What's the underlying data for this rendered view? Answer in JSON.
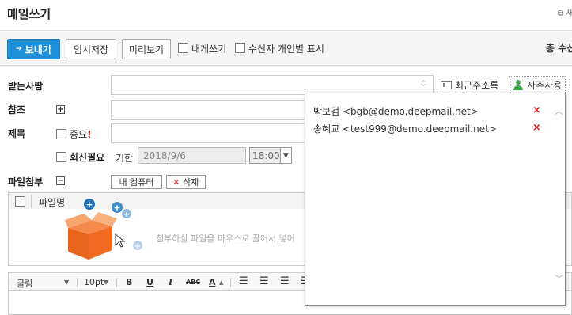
{
  "header": {
    "title": "메일쓰기",
    "popout_label": "새"
  },
  "toolbar": {
    "send_label": "보내기",
    "temp_save_label": "임시저장",
    "preview_label": "미리보기",
    "self_write_label": "내게쓰기",
    "individual_label": "수신자 개인별 표시",
    "total_label": "총 수신"
  },
  "form": {
    "recipient_label": "받는사람",
    "cc_label": "참조",
    "subject_label": "제목",
    "important_label": "중요",
    "reply_required_label": "회신필요",
    "deadline_label": "기한",
    "deadline_date": "2018/9/6",
    "deadline_time": "18:00",
    "recent_contacts_label": "최근주소록",
    "frequent_label": "자주사용",
    "attach_label": "파일첨부",
    "my_computer_label": "내 컴퓨터",
    "delete_label": "삭제"
  },
  "attachment": {
    "filename_header": "파일명",
    "drop_text": "첨부하실 파일을 마우스로 끌어서 넣어"
  },
  "editor": {
    "font_label": "굴림",
    "size_label": "10pt"
  },
  "popup": {
    "contacts": [
      {
        "label": "박보검 <bgb@demo.deepmail.net>"
      },
      {
        "label": "송혜교 <test999@demo.deepmail.net>"
      }
    ]
  },
  "colors": {
    "primary_button": "#1e90d8",
    "delete_x": "#dd2222",
    "important_mark": "#dd2222",
    "contact_icon": "#3aa84a",
    "upload_box": "#f06a22"
  }
}
